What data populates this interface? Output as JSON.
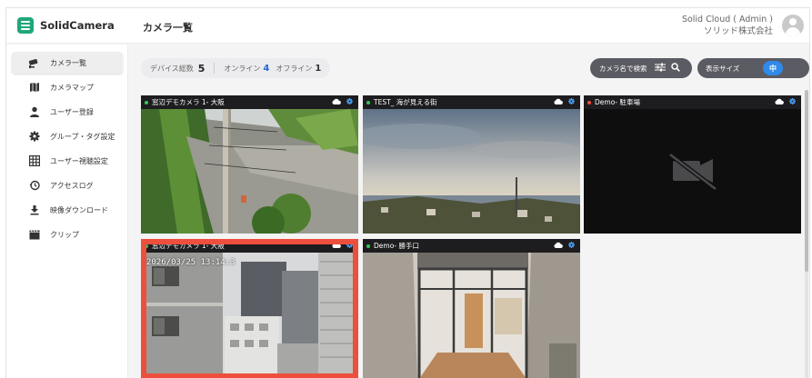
{
  "brand": {
    "name": "SolidCamera",
    "color": "#1fa77a"
  },
  "header": {
    "title": "カメラ一覧",
    "account": "Solid Cloud ( Admin )",
    "company": "ソリッド株式会社"
  },
  "sidebar": {
    "items": [
      {
        "label": "カメラ一覧",
        "icon": "camera-icon",
        "active": true
      },
      {
        "label": "カメラマップ",
        "icon": "map-icon"
      },
      {
        "label": "ユーザー登録",
        "icon": "user-icon"
      },
      {
        "label": "グループ・タグ設定",
        "icon": "gear-icon"
      },
      {
        "label": "ユーザー視聴設定",
        "icon": "grid-icon"
      },
      {
        "label": "アクセスログ",
        "icon": "history-icon"
      },
      {
        "label": "映像ダウンロード",
        "icon": "download-icon"
      },
      {
        "label": "クリップ",
        "icon": "clapper-icon"
      }
    ]
  },
  "counts": {
    "total_label": "デバイス総数",
    "total": "5",
    "online_label": "オンライン",
    "online": "4",
    "offline_label": "オフライン",
    "offline": "1"
  },
  "search": {
    "label": "カメラ名で検索"
  },
  "display_size": {
    "label": "表示サイズ",
    "value": "中"
  },
  "cameras": [
    {
      "name": "窓辺デモカメラ 1- 大阪",
      "status": "online",
      "status_color": "#35c759"
    },
    {
      "name": "TEST_ 海が見える街",
      "status": "online",
      "status_color": "#35c759"
    },
    {
      "name": "Demo- 駐車場",
      "status": "offline",
      "status_color": "#ee4e3c"
    },
    {
      "name": "窓辺デモカメラ 1- 大阪",
      "status": "online",
      "status_color": "#35c759",
      "selected": true,
      "timestamp": "2026/03/25 13:14:3"
    },
    {
      "name": "Demo- 勝手口",
      "status": "online",
      "status_color": "#35c759"
    }
  ],
  "colors": {
    "accent": "#2f8ae8",
    "selection": "#ee4e3c",
    "toolbar": "#5b5b63"
  }
}
